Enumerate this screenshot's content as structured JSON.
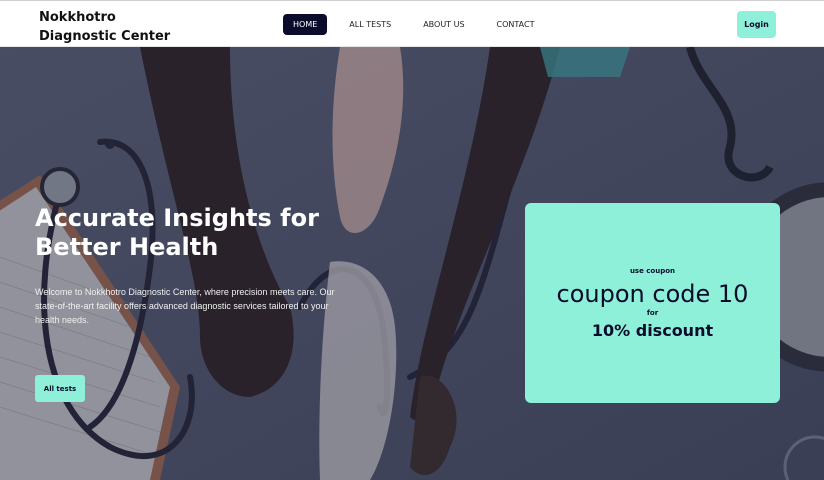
{
  "colors": {
    "accent": "#8ef0d8",
    "dark_navy": "#0b0b2c",
    "navbar_bg": "#ffffff"
  },
  "brand": {
    "line1": "Nokkhotro",
    "line2": "Diagnostic Center"
  },
  "nav": {
    "items": [
      {
        "label": "HOME",
        "active": true
      },
      {
        "label": "ALL TESTS",
        "active": false
      },
      {
        "label": "ABOUT US",
        "active": false
      },
      {
        "label": "CONTACT",
        "active": false
      }
    ],
    "login_label": "Login"
  },
  "hero": {
    "title": "Accurate Insights for Better Health",
    "description": "Welcome to Nokkhotro Diagnostic Center, where precision meets care. Our state-of-the-art facility offers advanced diagnostic services tailored to your health needs.",
    "button_label": "All tests",
    "background_image": "doctor-measuring-blood-pressure-photo"
  },
  "coupon": {
    "use_label": "use coupon",
    "code_text": "coupon code 10",
    "for_label": "for",
    "discount_text": "10% discount"
  }
}
